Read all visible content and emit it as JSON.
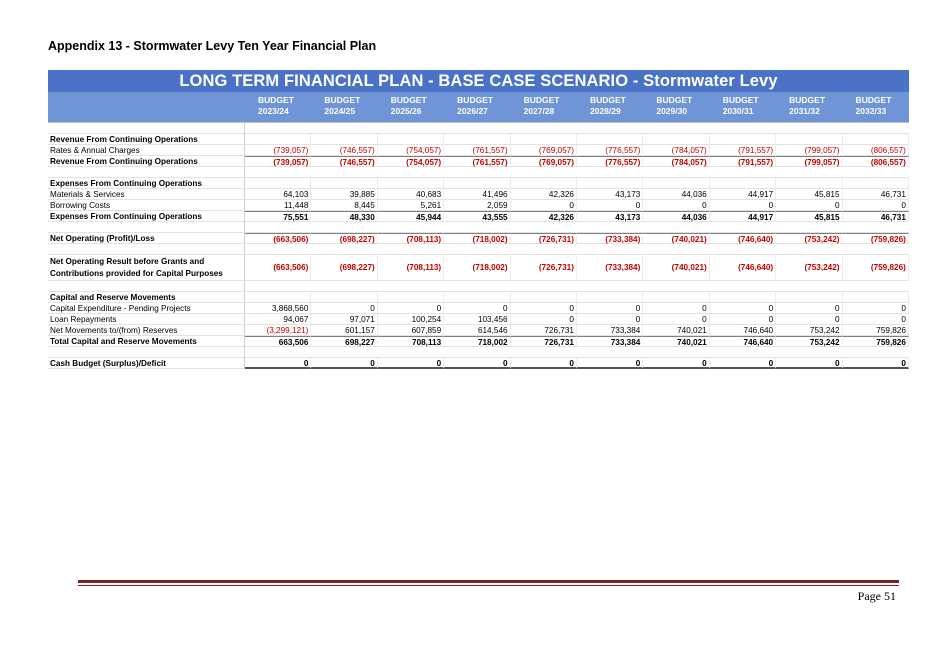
{
  "doc_title": "Appendix 13 - Stormwater Levy Ten Year Financial Plan",
  "banner": "LONG TERM FINANCIAL PLAN - BASE CASE SCENARIO - Stormwater Levy",
  "columns": [
    {
      "top": "BUDGET",
      "year": "2023/24"
    },
    {
      "top": "BUDGET",
      "year": "2024/25"
    },
    {
      "top": "BUDGET",
      "year": "2025/26"
    },
    {
      "top": "BUDGET",
      "year": "2026/27"
    },
    {
      "top": "BUDGET",
      "year": "2027/28"
    },
    {
      "top": "BUDGET",
      "year": "2028/29"
    },
    {
      "top": "BUDGET",
      "year": "2029/30"
    },
    {
      "top": "BUDGET",
      "year": "2030/31"
    },
    {
      "top": "BUDGET",
      "year": "2031/32"
    },
    {
      "top": "BUDGET",
      "year": "2032/33"
    }
  ],
  "rows": [
    {
      "type": "gap"
    },
    {
      "type": "section",
      "label": "Revenue From Continuing Operations"
    },
    {
      "type": "data",
      "label": "Rates & Annual Charges",
      "neg": true,
      "values": [
        "(739,057)",
        "(746,557)",
        "(754,057)",
        "(761,557)",
        "(769,057)",
        "(776,557)",
        "(784,057)",
        "(791,557)",
        "(799,057)",
        "(806,557)"
      ]
    },
    {
      "type": "total",
      "label": "Revenue From Continuing Operations",
      "neg": true,
      "values": [
        "(739,057)",
        "(746,557)",
        "(754,057)",
        "(761,557)",
        "(769,057)",
        "(776,557)",
        "(784,057)",
        "(791,557)",
        "(799,057)",
        "(806,557)"
      ]
    },
    {
      "type": "gap"
    },
    {
      "type": "section",
      "label": "Expenses From Continuing Operations"
    },
    {
      "type": "data",
      "label": "Materials & Services",
      "values": [
        "64,103",
        "39,885",
        "40,683",
        "41,496",
        "42,326",
        "43,173",
        "44,036",
        "44,917",
        "45,815",
        "46,731"
      ]
    },
    {
      "type": "data",
      "label": "Borrowing Costs",
      "values": [
        "11,448",
        "8,445",
        "5,261",
        "2,059",
        "0",
        "0",
        "0",
        "0",
        "0",
        "0"
      ]
    },
    {
      "type": "total",
      "label": "Expenses From Continuing Operations",
      "values": [
        "75,551",
        "48,330",
        "45,944",
        "43,555",
        "42,326",
        "43,173",
        "44,036",
        "44,917",
        "45,815",
        "46,731"
      ]
    },
    {
      "type": "gap"
    },
    {
      "type": "total",
      "label": "Net Operating (Profit)/Loss",
      "neg": true,
      "values": [
        "(663,506)",
        "(698,227)",
        "(708,113)",
        "(718,002)",
        "(726,731)",
        "(733,384)",
        "(740,021)",
        "(746,640)",
        "(753,242)",
        "(759,826)"
      ]
    },
    {
      "type": "gap"
    },
    {
      "type": "tall",
      "label": "Net Operating Result before Grants and",
      "label2": "Contributions provided for Capital Purposes",
      "neg": true,
      "values": [
        "(663,506)",
        "(698,227)",
        "(708,113)",
        "(718,002)",
        "(726,731)",
        "(733,384)",
        "(740,021)",
        "(746,640)",
        "(753,242)",
        "(759,826)"
      ]
    },
    {
      "type": "gap"
    },
    {
      "type": "section",
      "label": "Capital and Reserve Movements"
    },
    {
      "type": "data",
      "label": "Capital Expenditure - Pending Projects",
      "values": [
        "3,868,560",
        "0",
        "0",
        "0",
        "0",
        "0",
        "0",
        "0",
        "0",
        "0"
      ]
    },
    {
      "type": "data",
      "label": "Loan Repayments",
      "values": [
        "94,067",
        "97,071",
        "100,254",
        "103,456",
        "0",
        "0",
        "0",
        "0",
        "0",
        "0"
      ]
    },
    {
      "type": "data",
      "label": "Net Movements to/(from) Reserves",
      "firstneg": true,
      "values": [
        "(3,299,121)",
        "601,157",
        "607,859",
        "614,546",
        "726,731",
        "733,384",
        "740,021",
        "746,640",
        "753,242",
        "759,826"
      ]
    },
    {
      "type": "total",
      "label": "Total Capital and Reserve Movements",
      "values": [
        "663,506",
        "698,227",
        "708,113",
        "718,002",
        "726,731",
        "733,384",
        "740,021",
        "746,640",
        "753,242",
        "759,826"
      ]
    },
    {
      "type": "gap"
    },
    {
      "type": "dbl",
      "label": "Cash Budget (Surplus)/Deficit",
      "values": [
        "0",
        "0",
        "0",
        "0",
        "0",
        "0",
        "0",
        "0",
        "0",
        "0"
      ]
    }
  ],
  "page_number": "Page 51",
  "colors": {
    "banner": "#4a73c7",
    "header": "#6f95d6",
    "negative": "#c00000",
    "footer_rule": "#7b2222"
  }
}
